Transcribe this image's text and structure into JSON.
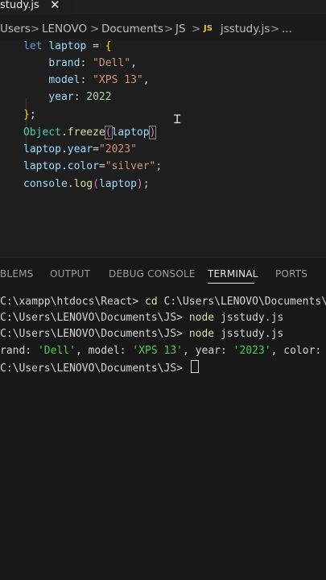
{
  "tab": {
    "label": "study.js",
    "close": "✕"
  },
  "breadcrumb": {
    "items": [
      "Users",
      "LENOVO",
      "Documents",
      "JS"
    ],
    "file_badge": "JS",
    "file": "jsstudy.js",
    "trail": "...",
    "separator": ">"
  },
  "editor": {
    "lines": [
      {
        "parts": [
          [
            "kw",
            "let"
          ],
          [
            "p",
            " "
          ],
          [
            "var",
            "laptop"
          ],
          [
            "p",
            " = "
          ],
          [
            "brace",
            "{"
          ]
        ]
      },
      {
        "parts": [
          [
            "p",
            "    "
          ],
          [
            "prop",
            "brand"
          ],
          [
            "p",
            ": "
          ],
          [
            "str",
            "\"Dell\""
          ],
          [
            "p",
            ","
          ]
        ]
      },
      {
        "parts": [
          [
            "p",
            "    "
          ],
          [
            "prop",
            "model"
          ],
          [
            "p",
            ": "
          ],
          [
            "str",
            "\"XPS 13\""
          ],
          [
            "p",
            ","
          ]
        ]
      },
      {
        "parts": [
          [
            "p",
            "    "
          ],
          [
            "prop",
            "year"
          ],
          [
            "p",
            ": "
          ],
          [
            "num",
            "2022"
          ]
        ]
      },
      {
        "parts": [
          [
            "brace",
            "}"
          ],
          [
            "p",
            ";"
          ]
        ]
      },
      {
        "parts": [
          [
            "cls",
            "Object"
          ],
          [
            "p",
            "."
          ],
          [
            "fn",
            "freeze"
          ],
          [
            "paren",
            "("
          ],
          [
            "var",
            "laptop"
          ],
          [
            "paren",
            ")"
          ]
        ]
      },
      {
        "parts": [
          [
            "var",
            "laptop"
          ],
          [
            "p",
            "."
          ],
          [
            "prop",
            "year"
          ],
          [
            "p",
            "="
          ],
          [
            "str",
            "\"2023\""
          ]
        ]
      },
      {
        "parts": [
          [
            "var",
            "laptop"
          ],
          [
            "p",
            "."
          ],
          [
            "prop",
            "color"
          ],
          [
            "p",
            "="
          ],
          [
            "str",
            "\"silver\""
          ],
          [
            "p",
            ";"
          ]
        ]
      },
      {
        "parts": [
          [
            "var",
            "console"
          ],
          [
            "p",
            "."
          ],
          [
            "fn",
            "log"
          ],
          [
            "paren",
            "("
          ],
          [
            "var",
            "laptop"
          ],
          [
            "paren",
            ")"
          ],
          [
            "p",
            ";"
          ]
        ]
      }
    ]
  },
  "panel": {
    "tabs": [
      "BLEMS",
      "OUTPUT",
      "DEBUG CONSOLE",
      "TERMINAL",
      "PORTS"
    ],
    "active_tab": "TERMINAL"
  },
  "terminal": {
    "lines": [
      {
        "prompt": "C:\\xampp\\htdocs\\React> ",
        "cmd": "cd",
        "rest": " C:\\Users\\LENOVO\\Documents\\JS"
      },
      {
        "prompt": "C:\\Users\\LENOVO\\Documents\\JS> ",
        "cmd": "node",
        "rest": " jsstudy.js"
      },
      {
        "prompt": "C:\\Users\\LENOVO\\Documents\\JS> ",
        "cmd": "node",
        "rest": " jsstudy.js"
      },
      {
        "output": [
          [
            "p",
            "rand: "
          ],
          [
            "str",
            "'Dell'"
          ],
          [
            "p",
            ", model: "
          ],
          [
            "str",
            "'XPS 13'"
          ],
          [
            "p",
            ", year: "
          ],
          [
            "str",
            "'2023'"
          ],
          [
            "p",
            ", color: "
          ]
        ]
      },
      {
        "prompt": "C:\\Users\\LENOVO\\Documents\\JS> ",
        "cursor": true
      }
    ]
  },
  "colors": {
    "background": "#1e1e1e",
    "panel": "#181818",
    "keyword": "#569cd6",
    "string": "#ce9178",
    "number": "#b5cea8",
    "function": "#dcdcaa",
    "class": "#4ec9b0",
    "bracket": "#ffd700",
    "paren": "#da70d6"
  }
}
